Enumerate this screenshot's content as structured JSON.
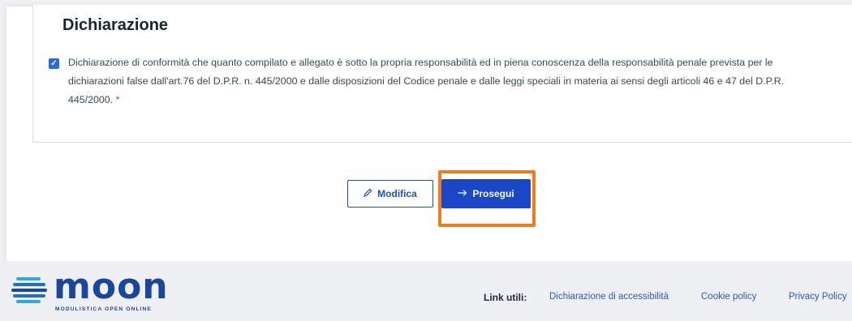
{
  "declaration": {
    "title": "Dichiarazione",
    "checkbox_checked": true,
    "text_line1": "Dichiarazione di conformità che quanto compilato e allegato è sotto la propria responsabilità ed in piena conoscenza della responsabilità penale prevista per le",
    "text_line2": "dichiarazioni false dall'art.76 del D.P.R. n. 445/2000 e dalle disposizioni del Codice penale e dalle leggi speciali in materia ai sensi degli articoli 46 e 47 del D.P.R.",
    "text_line3": "445/2000.",
    "required_mark": "*"
  },
  "actions": {
    "modifica_label": "Modifica",
    "prosegui_label": "Prosegui",
    "highlight_color": "#f07c1e"
  },
  "footer": {
    "logo_text": "moon",
    "logo_subtitle": "MODULISTICA OPEN ONLINE",
    "links_label": "Link utili:",
    "links": [
      "Dichiarazione di accessibilità",
      "Cookie policy",
      "Privacy Policy"
    ]
  },
  "colors": {
    "primary": "#1b46c8",
    "brand": "#17479e",
    "required": "#d32f2f"
  }
}
